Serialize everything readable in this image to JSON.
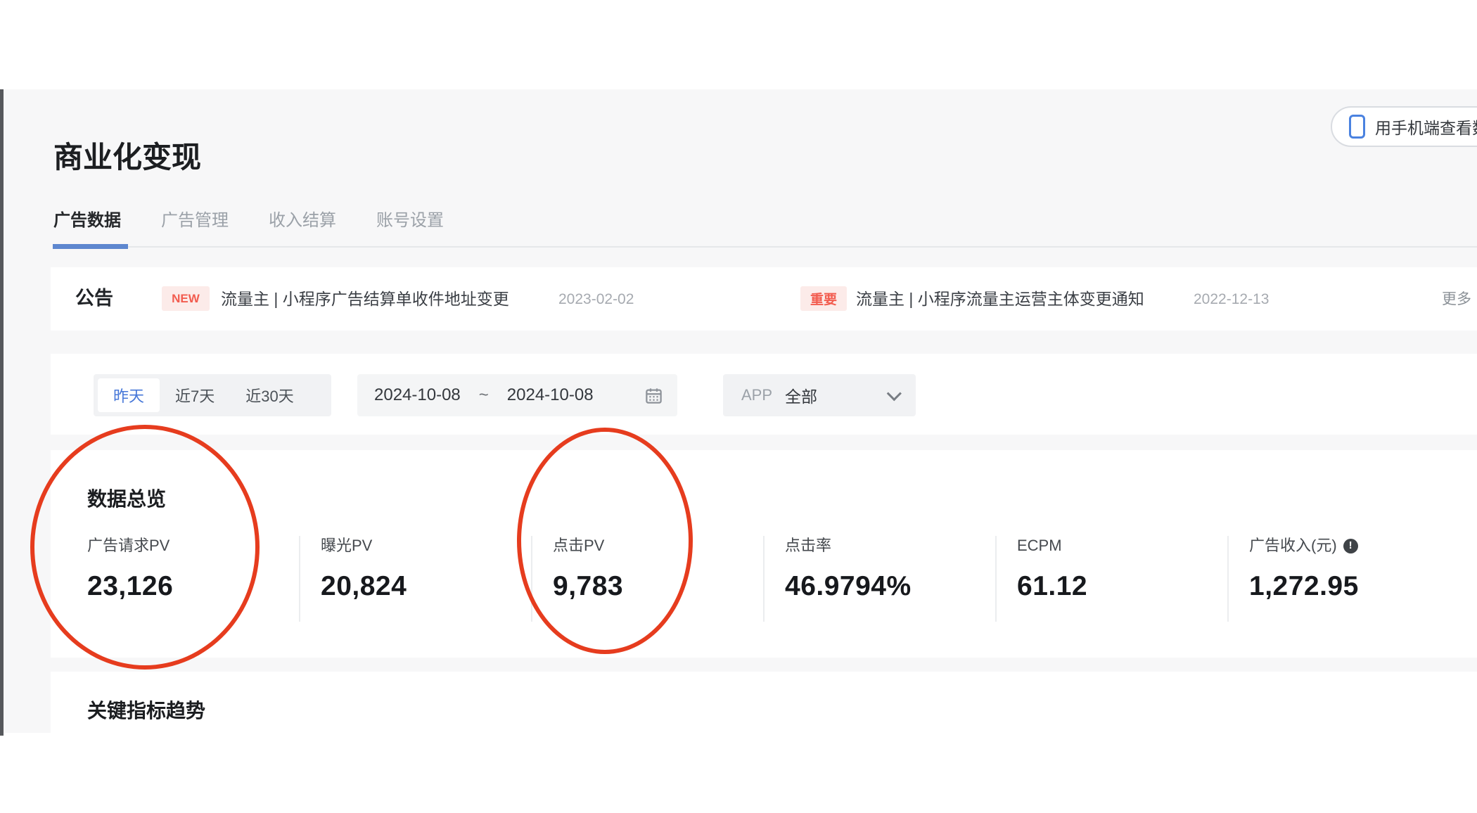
{
  "header": {
    "title": "商业化变现",
    "mobile_view_button": "用手机端查看数据"
  },
  "tabs": [
    {
      "label": "广告数据",
      "active": true
    },
    {
      "label": "广告管理",
      "active": false
    },
    {
      "label": "收入结算",
      "active": false
    },
    {
      "label": "账号设置",
      "active": false
    }
  ],
  "announcement": {
    "heading": "公告",
    "items": [
      {
        "badge": "NEW",
        "text": "流量主 | 小程序广告结算单收件地址变更",
        "date": "2023-02-02"
      },
      {
        "badge": "重要",
        "text": "流量主 | 小程序流量主运营主体变更通知",
        "date": "2022-12-13"
      }
    ],
    "more": "更多"
  },
  "filters": {
    "quick_ranges": [
      {
        "label": "昨天",
        "selected": true
      },
      {
        "label": "近7天",
        "selected": false
      },
      {
        "label": "近30天",
        "selected": false
      }
    ],
    "date_range": {
      "start": "2024-10-08",
      "separator": "~",
      "end": "2024-10-08"
    },
    "app_filter": {
      "label": "APP",
      "value": "全部"
    }
  },
  "overview": {
    "title": "数据总览",
    "metrics": [
      {
        "label": "广告请求PV",
        "value": "23,126"
      },
      {
        "label": "曝光PV",
        "value": "20,824"
      },
      {
        "label": "点击PV",
        "value": "9,783"
      },
      {
        "label": "点击率",
        "value": "46.9794%"
      },
      {
        "label": "ECPM",
        "value": "61.12"
      },
      {
        "label": "广告收入(元)",
        "value": "1,272.95",
        "info_badge": "!"
      }
    ]
  },
  "trends": {
    "title": "关键指标趋势"
  },
  "colors": {
    "tab_indicator": "#5e87cf",
    "selected_range_text": "#4677d8",
    "badge_text": "#f25c4f",
    "badge_bg": "#fcebe9",
    "annotation_red": "#e63c1e",
    "content_bg": "#f7f7f8"
  }
}
